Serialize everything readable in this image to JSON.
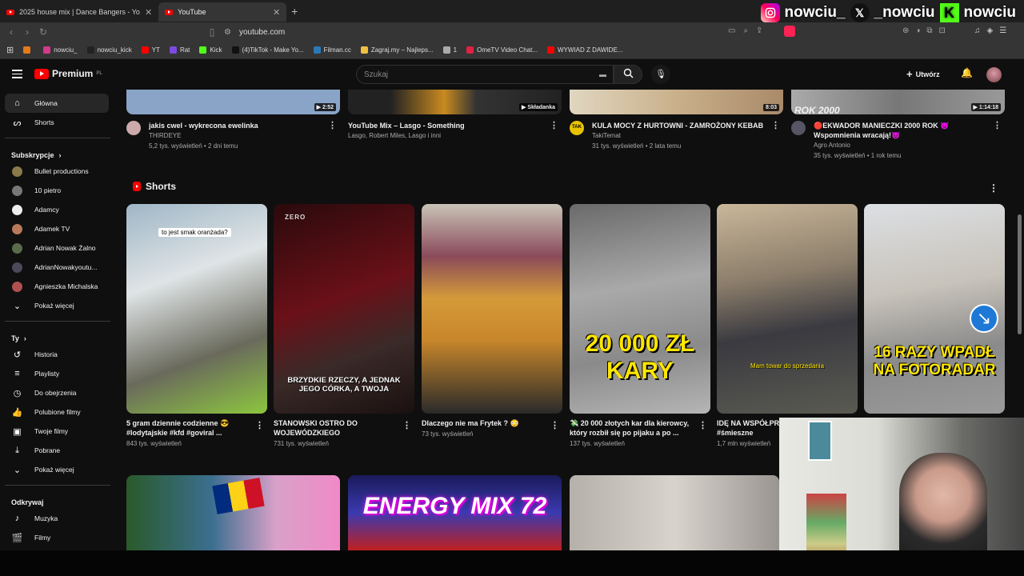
{
  "browser": {
    "tabs": [
      {
        "label": "2025 house mix | Dance Bangers - Yo"
      },
      {
        "label": "YouTube"
      }
    ],
    "url": "youtube.com",
    "bookmarks": [
      {
        "label": "",
        "color": "#e57a1b"
      },
      {
        "label": "nowciu_",
        "color": "#d33a8a"
      },
      {
        "label": "nowciu_kick",
        "color": "#222"
      },
      {
        "label": "YT",
        "color": "#f00"
      },
      {
        "label": "Rat",
        "color": "#7b4ae0"
      },
      {
        "label": "Kick",
        "color": "#53fc18"
      },
      {
        "label": "(4)TikTok - Make Yo...",
        "color": "#111"
      },
      {
        "label": "Filman.cc",
        "color": "#2a7ab8"
      },
      {
        "label": "Zagraj.my – Najleps...",
        "color": "#f0c040"
      },
      {
        "label": "1",
        "color": "#aaa"
      },
      {
        "label": "OmeTV Video Chat...",
        "color": "#d24"
      },
      {
        "label": "WYWIAD Z DAWIDE...",
        "color": "#f00"
      }
    ]
  },
  "overlay": {
    "instagram": "nowciu_",
    "x": "_nowciu",
    "kick": "nowciu"
  },
  "header": {
    "brand": "Premium",
    "region": "PL",
    "search_placeholder": "Szukaj",
    "create_label": "Utwórz"
  },
  "sidebar": {
    "main": [
      {
        "label": "Główna",
        "icon": "home-icon"
      },
      {
        "label": "Shorts",
        "icon": "shorts-icon"
      }
    ],
    "subs_title": "Subskrypcje",
    "subs": [
      {
        "label": "Bullet productions",
        "color": "#8a7a4a"
      },
      {
        "label": "10 pietro",
        "color": "#777"
      },
      {
        "label": "Adamcy",
        "color": "#eee"
      },
      {
        "label": "Adamek TV",
        "color": "#b7795a"
      },
      {
        "label": "Adrian Nowak Żalno",
        "color": "#5a6b4a"
      },
      {
        "label": "AdrianNowakyoutu...",
        "color": "#4a4a5a"
      },
      {
        "label": "Agnieszka Michalska",
        "color": "#b05050"
      }
    ],
    "show_more": "Pokaż więcej",
    "you_title": "Ty",
    "you": [
      {
        "label": "Historia",
        "icon": "history-icon"
      },
      {
        "label": "Playlisty",
        "icon": "playlist-icon"
      },
      {
        "label": "Do obejrzenia",
        "icon": "clock-icon"
      },
      {
        "label": "Polubione filmy",
        "icon": "thumb-up-icon"
      },
      {
        "label": "Twoje filmy",
        "icon": "play-square-icon"
      },
      {
        "label": "Pobrane",
        "icon": "download-icon"
      }
    ],
    "show_more2": "Pokaż więcej",
    "explore_title": "Odkrywaj",
    "explore": [
      {
        "label": "Muzyka",
        "icon": "music-icon"
      },
      {
        "label": "Filmy",
        "icon": "film-icon"
      }
    ]
  },
  "videos": [
    {
      "title": "jakis cwel - wykrecona ewelinka",
      "line2": "THIRDEYE",
      "line3": "5,2 tys. wyświetleń • 2 dni temu",
      "duration": "2:52",
      "thumb": "#8aa4c8",
      "avatar": "#caa"
    },
    {
      "title": "YouTube Mix – Lasgo - Something",
      "line2": "Lasgo, Robert Miles, Lasgo i inni",
      "line3": "",
      "duration": "Składanka",
      "thumb": "#c98a20",
      "avatar": ""
    },
    {
      "title": "KULA MOCY Z HURTOWNI - ZAMROŻONY KEBAB",
      "line2": "TakiTemat",
      "line3": "31 tys. wyświetleń • 2 lata temu",
      "duration": "8:03",
      "thumb": "#c9b08a",
      "avatar": "#e8c400"
    },
    {
      "title": "🔴EKWADOR MANIECZKI 2000 ROK 👿 Wspomnienia wracają!😈",
      "line2": "Agro Antonio",
      "line3": "35 tys. wyświetleń • 1 rok temu",
      "duration": "1:14:18",
      "thumb": "#8d8d8d",
      "avatar": "#556"
    }
  ],
  "shorts_title": "Shorts",
  "shorts": [
    {
      "title": "5 gram dziennie codzienne 😎 #lodytajskie #kfd #goviral ...",
      "views": "843 tys. wyświetleń",
      "caption": "to jest smak oranżada?",
      "bg": "linear-gradient(160deg,#9fb6c6 0%,#dfe4e6 35%,#6a6a5c 70%,#8cc63f 100%)"
    },
    {
      "title": "STANOWSKI OSTRO DO WOJEWÓDZKIEGO",
      "views": "731 tys. wyświetleń",
      "caption": "BRZYDKIE RZECZY, A JEDNAK JEGO CÓRKA, A TWOJA",
      "bg": "linear-gradient(160deg,#2a0a0c 0%,#6a1018 45%,#3a2a28 70%,#1a1010 100%)"
    },
    {
      "title": "Dlaczego nie ma Frytek ? 😳",
      "views": "73 tys. wyświetleń",
      "caption": "",
      "bg": "linear-gradient(180deg,#c9c3b7 0%,#8a4a5a 25%,#d49a3a 45%,#c8862a 65%,#2a2a2a 100%)"
    },
    {
      "title": "💸 20 000 złotych kar dla kierowcy, który rozbił się po pijaku a po ...",
      "views": "137 tys. wyświetleń",
      "caption": "20 000 ZŁ KARY",
      "bg": "linear-gradient(170deg,#6a6a6a 0%,#a9a9a9 40%,#8a8a8a 70%,#b5b5b5 100%)"
    },
    {
      "title": "IDĘ NA WSPÓŁPRACĘ #polska #śmieszne",
      "views": "1,7 mln wyświetleń",
      "caption": "Mam towar do sprzedania",
      "bg": "linear-gradient(170deg,#c9b79a 0%,#8b7d6a 35%,#3a3a40 60%,#5a5a52 100%)"
    },
    {
      "title": "",
      "views": "",
      "caption": "16 RAZY WPADŁ NA FOTORADAR",
      "bg": "linear-gradient(170deg,#dcdfe3 0%,#c8c3bb 40%,#8a8a8a 70%,#9a9a9a 100%)"
    }
  ],
  "row3": [
    {
      "bg": "linear-gradient(90deg,#2a5a2a,#3b6f8f 40%,#d9a1c9 70%,#f08ac8)"
    },
    {
      "bg": "linear-gradient(180deg,#1a1a5a,#3a3ab0 50%,#c02020)",
      "text": "ENERGY MIX 72"
    },
    {
      "bg": "linear-gradient(90deg,#b5b0aa,#d8d3cd 50%,#9a9590)"
    }
  ]
}
